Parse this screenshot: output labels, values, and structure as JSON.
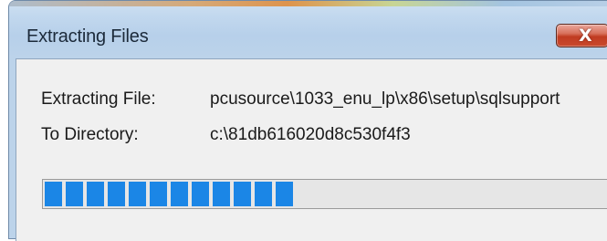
{
  "window": {
    "title": "Extracting Files",
    "close_label": "X"
  },
  "fields": {
    "file_label": "Extracting File:",
    "file_value": "pcusource\\1033_enu_lp\\x86\\setup\\sqlsupport",
    "dir_label": "To Directory:",
    "dir_value": "c:\\81db616020d8c530f4f3"
  },
  "progress": {
    "percent": 43,
    "color": "#1b86e6"
  },
  "colors": {
    "title_text": "#1c2a3a",
    "close_button": "#c03b21",
    "client_background": "#f0f0f0"
  }
}
